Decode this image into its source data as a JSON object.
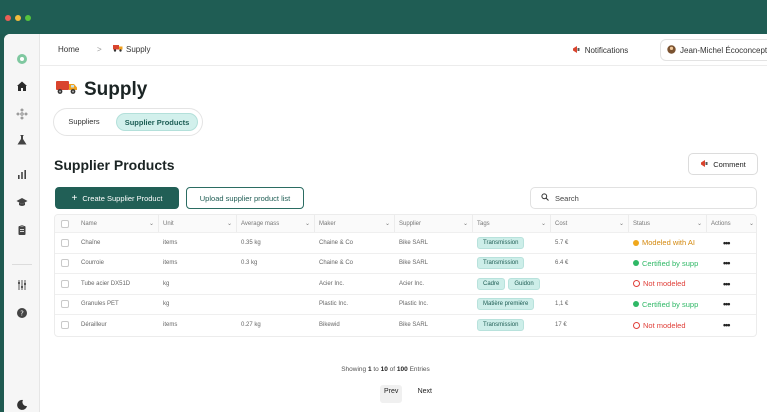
{
  "window": {
    "buttons": [
      "close",
      "minimize",
      "maximize"
    ]
  },
  "rail": {
    "icons": [
      "logo-icon",
      "home-icon",
      "network-icon",
      "flask-icon",
      "bar-chart-icon",
      "graduation-cap-icon",
      "clipboard-icon",
      "sliders-icon",
      "help-icon",
      "moon-icon"
    ]
  },
  "breadcrumb": {
    "home": "Home",
    "separator": ">",
    "current": "Supply"
  },
  "header": {
    "notifications": "Notifications",
    "user": "Jean-Michel Écoconception"
  },
  "page": {
    "title": "Supply"
  },
  "tabs": [
    {
      "label": "Suppliers",
      "active": false
    },
    {
      "label": "Supplier Products",
      "active": true
    }
  ],
  "section": {
    "title": "Supplier Products",
    "comment_label": "Comment",
    "create_label": "Create Supplier Product",
    "upload_label": "Upload supplier product list",
    "search_placeholder": "Search"
  },
  "table": {
    "columns": [
      "Name",
      "Unit",
      "Average mass",
      "Maker",
      "Supplier",
      "Tags",
      "Cost",
      "Status",
      "Actions"
    ],
    "rows": [
      {
        "name": "Chaîne",
        "unit": "items",
        "mass": "0.35 kg",
        "maker": "Chaine & Co",
        "supplier": "Bike SARL",
        "tags": [
          "Transmission"
        ],
        "cost": "5.7 €",
        "status": "Modeled with AI",
        "status_kind": "ai",
        "actions": "•••"
      },
      {
        "name": "Courroie",
        "unit": "items",
        "mass": "0.3 kg",
        "maker": "Chaine & Co",
        "supplier": "Bike SARL",
        "tags": [
          "Transmission"
        ],
        "cost": "6.4 €",
        "status": "Certified by supp",
        "status_kind": "certified",
        "actions": "•••"
      },
      {
        "name": "Tube acier DX51D",
        "unit": "kg",
        "mass": "",
        "maker": "Acier Inc.",
        "supplier": "Acier Inc.",
        "tags": [
          "Cadre",
          "Guidon"
        ],
        "cost": "",
        "status": "Not modeled",
        "status_kind": "none",
        "actions": "•••"
      },
      {
        "name": "Granules PET",
        "unit": "kg",
        "mass": "",
        "maker": "Plastic Inc.",
        "supplier": "Plastic Inc.",
        "tags": [
          "Matière première"
        ],
        "cost": "1,1 €",
        "status": "Certified by supp",
        "status_kind": "certified",
        "actions": "•••"
      },
      {
        "name": "Dérailleur",
        "unit": "items",
        "mass": "0.27 kg",
        "maker": "Bikewid",
        "supplier": "Bike SARL",
        "tags": [
          "Transmission"
        ],
        "cost": "17 €",
        "status": "Not modeled",
        "status_kind": "none",
        "actions": "•••"
      }
    ]
  },
  "pagination": {
    "prefix": "Showing",
    "from": "1",
    "to_word": "to",
    "to": "10",
    "of_word": "of",
    "total": "100",
    "suffix": "Entries",
    "prev": "Prev",
    "next": "Next"
  },
  "colors": {
    "brand": "#215f56",
    "tag_bg": "#cdeee9",
    "ai": "#f0a81c",
    "certified": "#2fb866",
    "not_modeled": "#e0403a"
  }
}
